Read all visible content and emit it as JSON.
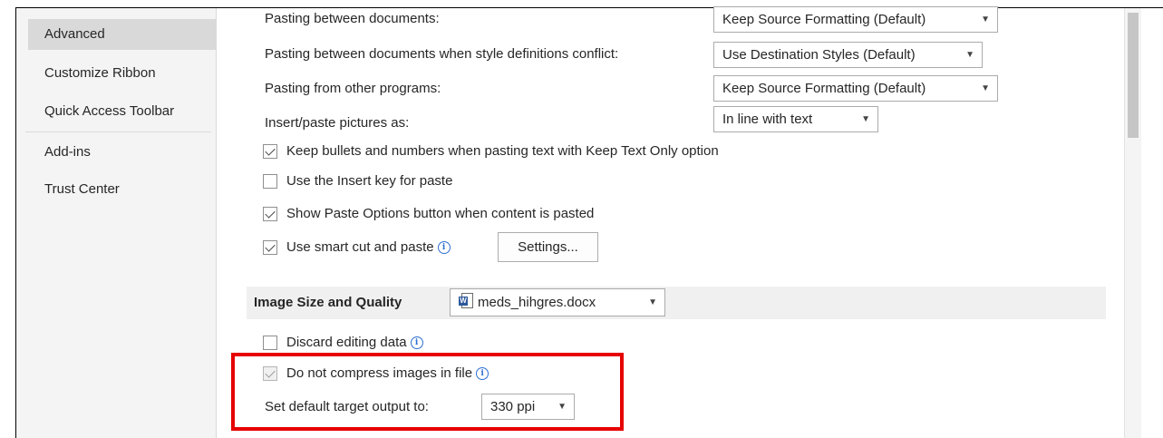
{
  "sidebar": {
    "items": [
      {
        "label": "Advanced",
        "selected": true
      },
      {
        "label": "Customize Ribbon"
      },
      {
        "label": "Quick Access Toolbar"
      },
      {
        "label": "Add-ins"
      },
      {
        "label": "Trust Center"
      }
    ]
  },
  "paste": {
    "between_docs": {
      "label": "Pasting between documents:",
      "value": "Keep Source Formatting (Default)"
    },
    "style_conflict": {
      "label": "Pasting between documents when style definitions conflict:",
      "value": "Use Destination Styles (Default)"
    },
    "other_programs": {
      "label": "Pasting from other programs:",
      "value": "Keep Source Formatting (Default)"
    },
    "pictures_as": {
      "label": "Insert/paste pictures as:",
      "value": "In line with text"
    },
    "keep_bullets": {
      "label": "Keep bullets and numbers when pasting text with Keep Text Only option",
      "checked": true
    },
    "insert_key": {
      "label": "Use the Insert key for paste",
      "checked": false
    },
    "show_paste_options": {
      "label": "Show Paste Options button when content is pasted",
      "checked": true
    },
    "smart_cut": {
      "label": "Use smart cut and paste",
      "checked": true
    },
    "settings_button": "Settings..."
  },
  "image_quality": {
    "title": "Image Size and Quality",
    "document": "meds_hihgres.docx",
    "discard_editing": {
      "label": "Discard editing data",
      "checked": false
    },
    "no_compress": {
      "label": "Do not compress images in file",
      "checked": true,
      "disabled": true
    },
    "target_output": {
      "label": "Set default target output to:",
      "value": "330 ppi"
    }
  },
  "colors": {
    "highlight": "#e60000",
    "word_blue": "#2b579a",
    "info_blue": "#2e6fd1"
  },
  "icons": {
    "dropdown": "chevron-down-icon",
    "info": "info-icon",
    "document": "word-document-icon",
    "check": "checkmark-icon"
  }
}
